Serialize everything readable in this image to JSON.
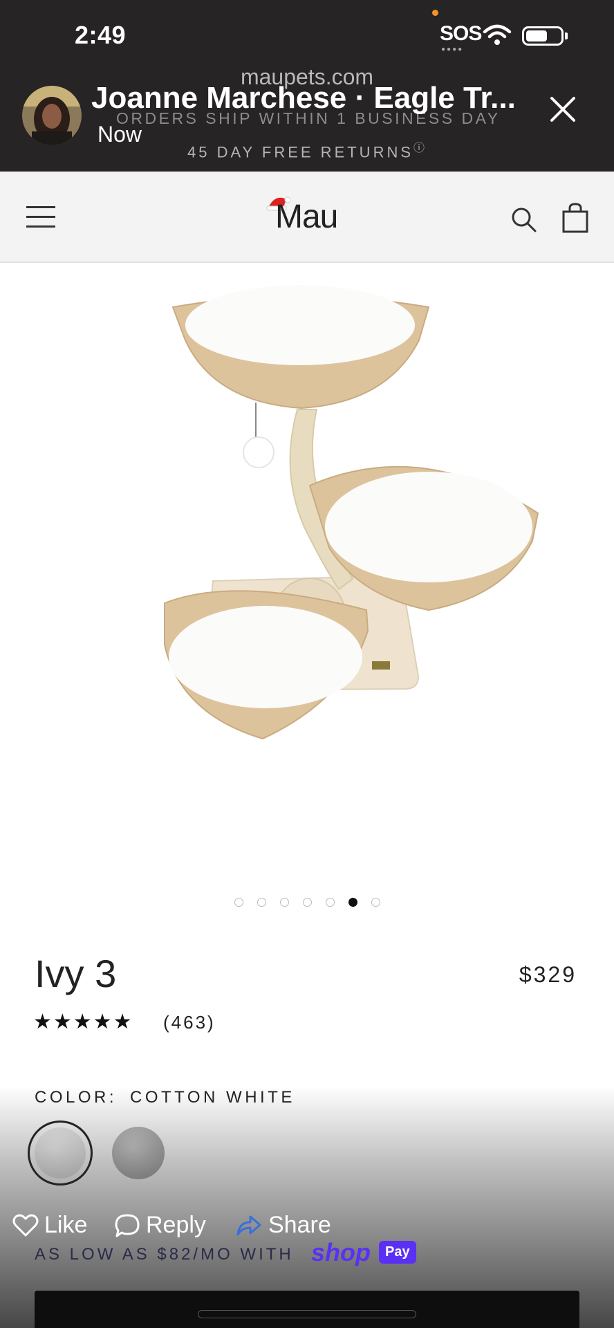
{
  "status_bar": {
    "time": "2:49",
    "carrier_status": "SOS",
    "icons": [
      "wifi-icon",
      "battery-icon"
    ]
  },
  "story": {
    "poster": "Joanne Marchese · Eagle Tr...",
    "posted": "Now",
    "site_domain": "maupets.com",
    "close_icon": "close-icon"
  },
  "banner": {
    "shipping": "ORDERS SHIP WITHIN 1 BUSINESS DAY",
    "returns": "45 DAY FREE RETURNS",
    "returns_info_icon": "ⓘ"
  },
  "header": {
    "logo": "Mau",
    "icons": [
      "menu-icon",
      "search-icon",
      "cart-icon"
    ]
  },
  "gallery": {
    "total": 7,
    "active_index": 5
  },
  "product": {
    "name": "Ivy 3",
    "price": "$329",
    "rating": 5,
    "stars": "★★★★★",
    "reviews": "(463)",
    "color_label": "COLOR:",
    "color_value": "COTTON WHITE",
    "swatches": [
      "Cotton White",
      "Gray"
    ]
  },
  "actions": {
    "like": "Like",
    "reply": "Reply",
    "share": "Share"
  },
  "financing": {
    "text": "AS LOW AS $82/MO WITH",
    "shop": "shop",
    "pay": "Pay"
  },
  "colors": {
    "overlay_bg": "#272425",
    "shop_purple": "#5a31f4",
    "header_bg": "#f3f3f3"
  }
}
